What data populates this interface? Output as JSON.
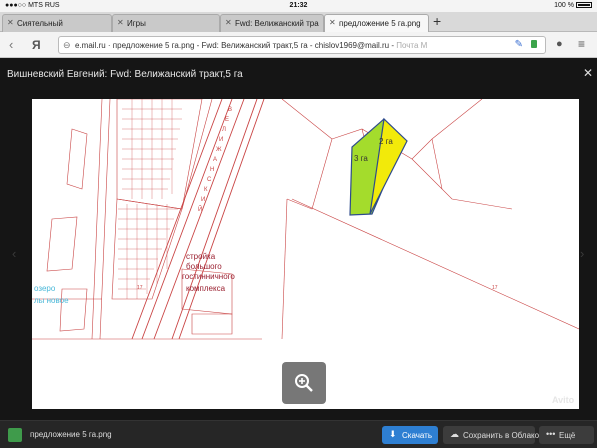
{
  "status": {
    "carrier": "MTS RUS",
    "time": "21:32",
    "battery": "100 %"
  },
  "tabs": [
    {
      "label": "Сиятельный",
      "active": false
    },
    {
      "label": "Игры",
      "active": false
    },
    {
      "label": "Fwd: Велижанский тра",
      "active": false
    },
    {
      "label": "предложение 5 га.png",
      "active": true
    }
  ],
  "addressbar": {
    "logo": "Я",
    "url": "e.mail.ru · предложение 5 га.png - Fwd: Велижанский тракт,5 га - chislov1969@mail.ru - ",
    "url_hint": "Почта M"
  },
  "viewer": {
    "title": "Вишневский Евгений: Fwd: Велижанский тракт,5 га"
  },
  "map": {
    "plot_small": "2 га",
    "plot_large": "3 га",
    "construction": [
      "стройка",
      "большого",
      "гостинничного",
      "комплекса"
    ],
    "lake": [
      "озеро",
      "лы новое"
    ],
    "road": [
      "В",
      "Е",
      "Л",
      "И",
      "Ж",
      "А",
      "Н",
      "С",
      "К",
      "И",
      "Й"
    ],
    "parcel_number": "17",
    "watermark": "Avito",
    "colors": {
      "yellow_plot": "#f2ea0a",
      "green_plot": "#a4dc2c",
      "outline": "#2e4b8c",
      "lines": "#c94444"
    }
  },
  "bottombar": {
    "filename": "предложение 5 га.png",
    "download": "Скачать",
    "save_cloud": "Сохранить в Облако",
    "more": "Ещё"
  }
}
